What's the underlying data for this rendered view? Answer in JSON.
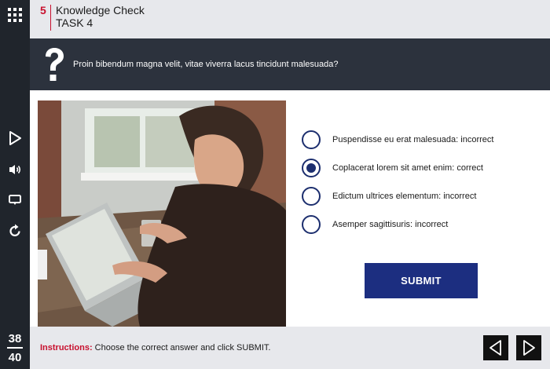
{
  "header": {
    "slide_number": "5",
    "title": "Knowledge Check",
    "subtitle": "TASK 4"
  },
  "question": {
    "text": "Proin bibendum magna velit, vitae viverra lacus tincidunt malesuada?"
  },
  "options": [
    {
      "label": "Puspendisse eu erat malesuada: incorrect",
      "selected": false
    },
    {
      "label": "Coplacerat lorem sit amet enim: correct",
      "selected": true
    },
    {
      "label": "Edictum ultrices elementum: incorrect",
      "selected": false
    },
    {
      "label": "Asemper sagittisuris: incorrect",
      "selected": false
    }
  ],
  "submit_label": "SUBMIT",
  "footer": {
    "instructions_label": "Instructions:",
    "instructions_text": " Choose the correct answer and click SUBMIT."
  },
  "progress": {
    "current": "38",
    "total": "40"
  },
  "icons": {
    "menu": "grid-menu-icon",
    "play": "play-icon",
    "volume": "volume-icon",
    "captions": "captions-icon",
    "replay": "replay-icon",
    "prev": "prev-arrow-icon",
    "next": "next-arrow-icon"
  },
  "colors": {
    "accent": "#c8102e",
    "primary": "#1c2e80",
    "rail": "#20252c",
    "question_band": "#2c323d"
  }
}
